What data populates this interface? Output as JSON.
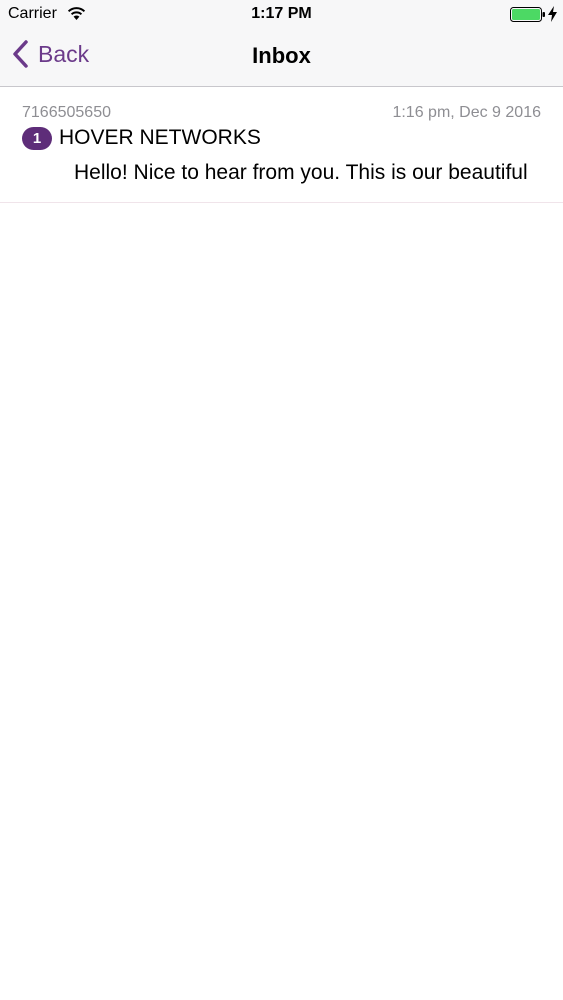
{
  "status_bar": {
    "carrier": "Carrier",
    "time": "1:17 PM",
    "wifi_icon": "wifi-icon",
    "battery_icon": "battery-full-icon",
    "battery_color": "#4cd964",
    "charging_icon": "lightning-bolt-icon"
  },
  "nav": {
    "back_label": "Back",
    "back_icon": "chevron-left-icon",
    "title": "Inbox",
    "accent_color": "#6b3a8a"
  },
  "messages": [
    {
      "number": "7166505650",
      "timestamp": "1:16 pm, Dec 9 2016",
      "unread_count": "1",
      "sender": "HOVER NETWORKS",
      "preview": "Hello! Nice to hear from you. This is our beautiful",
      "badge_color": "#5e2d79"
    }
  ]
}
